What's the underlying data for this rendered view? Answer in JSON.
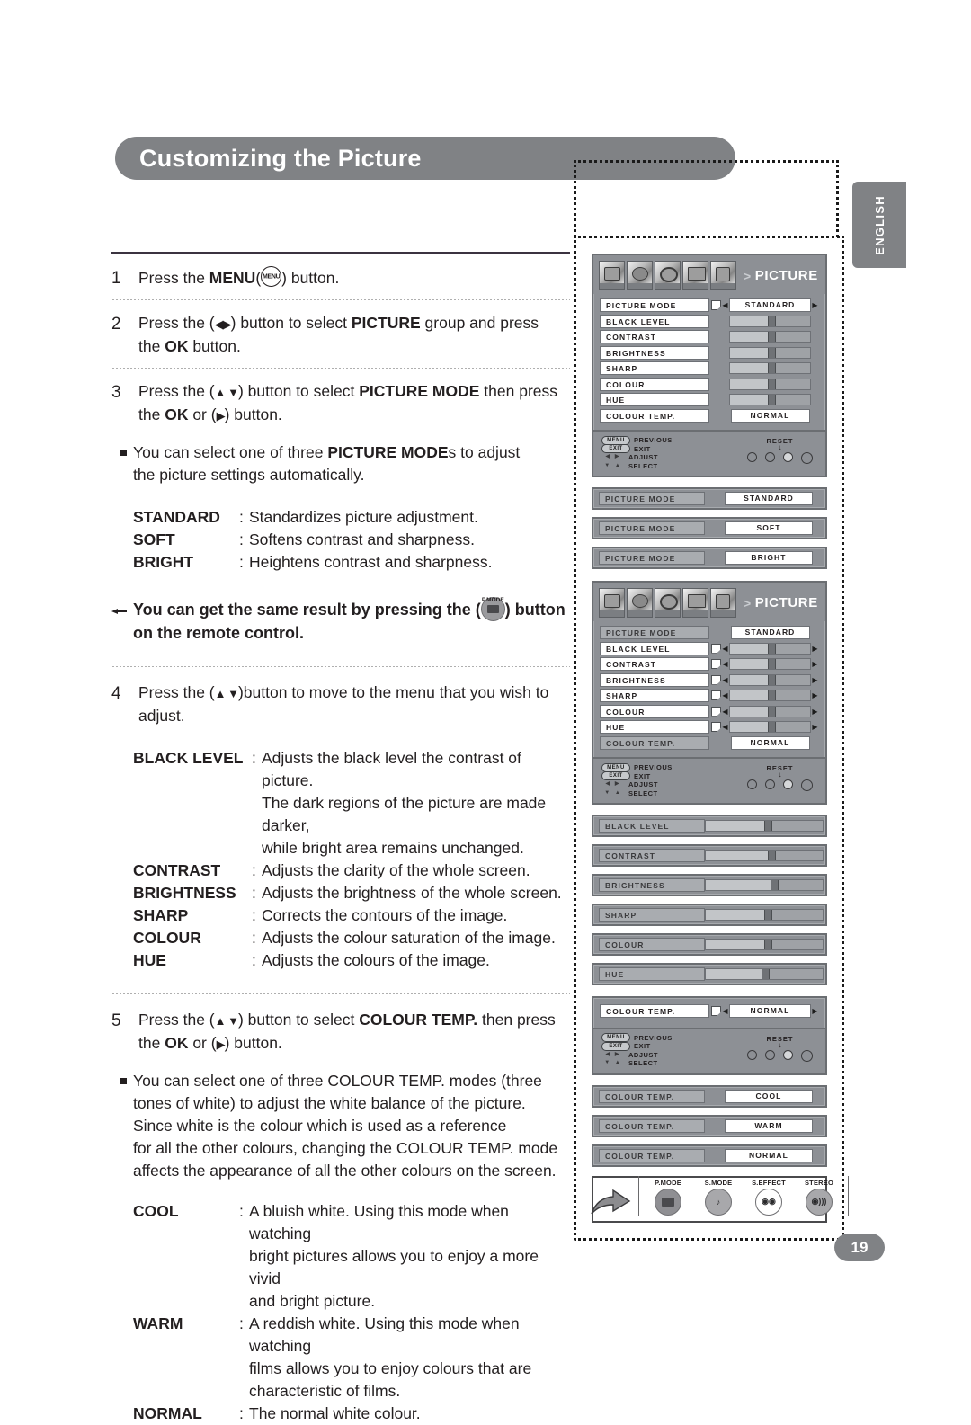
{
  "page_title": "Customizing the Picture",
  "language_tab": "ENGLISH",
  "page_number": "19",
  "colors": {
    "banner": "#808285",
    "osd_panel": "#8d9095",
    "text": "#231f20"
  },
  "steps": [
    {
      "num": "1",
      "parts": [
        {
          "t": "Press the ",
          "b": false
        },
        {
          "t": "MENU",
          "b": true
        },
        {
          "t": "(",
          "b": false
        },
        {
          "t": "@menu-icon",
          "b": false
        },
        {
          "t": ") button.",
          "b": false
        }
      ],
      "plain": "Press the MENU(MENU) button."
    },
    {
      "num": "2",
      "line1_a": "Press the (",
      "line1_arrows": "◀▶",
      "line1_b": ") button to select ",
      "line1_bold": "PICTURE",
      "line1_c": " group and press",
      "line2_a": "the ",
      "line2_bold": "OK",
      "line2_b": " button."
    },
    {
      "num": "3",
      "line1_a": "Press the (",
      "line1_arrows": "▲ ▼",
      "line1_b": ") button to select ",
      "line1_bold": "PICTURE MODE",
      "line1_c": " then press",
      "line2_a": "the ",
      "line2_bold": "OK",
      "line2_b": " or (",
      "line2_arrows": "▶",
      "line2_c": ") button."
    },
    {
      "num": "4",
      "line1_a": "Press the (",
      "line1_arrows": "▲ ▼",
      "line1_b": ")button to move to the menu that you wish to",
      "line2_a": "adjust.",
      "line2_bold": "",
      "line2_b": ""
    },
    {
      "num": "5",
      "line1_a": "Press the (",
      "line1_arrows": "▲ ▼",
      "line1_b": ") button to select ",
      "line1_bold": "COLOUR TEMP.",
      "line1_c": " then press",
      "line2_a": "the ",
      "line2_bold": "OK",
      "line2_b": " or (",
      "line2_arrows": "▶",
      "line2_c": ") button."
    }
  ],
  "bullet_step3": {
    "line1_a": "You can select one of three ",
    "line1_bold": "PICTURE MODE",
    "line1_b": "s to adjust",
    "line2": "the picture settings automatically."
  },
  "picture_modes": [
    {
      "term": "STANDARD",
      "sep": ":",
      "desc": "Standardizes picture adjustment."
    },
    {
      "term": "SOFT",
      "sep": ":",
      "desc": "Softens contrast and sharpness."
    },
    {
      "term": "BRIGHT",
      "sep": ":",
      "desc": "Heightens contrast and sharpness."
    }
  ],
  "remote_note": {
    "line1_a": "You can get the same result by pressing the (",
    "button_label": "P.MODE",
    "line1_b": ") button",
    "line2": "on the remote control."
  },
  "picture_items": [
    {
      "term": "BLACK LEVEL",
      "sep": ":",
      "desc": "Adjusts the black level the contrast of picture.",
      "cont": [
        "The dark regions of the picture are made darker,",
        "while bright area remains unchanged."
      ]
    },
    {
      "term": "CONTRAST",
      "sep": ":",
      "desc": "Adjusts the clarity of the whole screen.",
      "cont": []
    },
    {
      "term": "BRIGHTNESS",
      "sep": ":",
      "desc": "Adjusts the brightness of the whole screen.",
      "cont": []
    },
    {
      "term": "SHARP",
      "sep": ":",
      "desc": "Corrects the contours of the image.",
      "cont": []
    },
    {
      "term": "COLOUR",
      "sep": ":",
      "desc": "Adjusts the colour saturation of the image.",
      "cont": []
    },
    {
      "term": "HUE",
      "sep": ":",
      "desc": "Adjusts the colours of the image.",
      "cont": []
    }
  ],
  "bullet_step5": [
    "You can select one of three COLOUR TEMP. modes (three",
    "tones of white) to adjust the white balance of the picture.",
    "Since white is the colour which is used as a reference",
    "for all the other colours, changing the COLOUR TEMP. mode",
    "affects the appearance of all the other colours on the screen."
  ],
  "colour_temp_items": [
    {
      "term": "COOL",
      "sep": ":",
      "desc": "A bluish white. Using this mode when watching",
      "cont": [
        "bright pictures allows you to enjoy a more vivid",
        "and bright picture."
      ]
    },
    {
      "term": "WARM",
      "sep": ":",
      "desc": "A reddish white. Using this mode when watching",
      "cont": [
        "films allows you to enjoy colours that are",
        "characteristic of films."
      ]
    },
    {
      "term": "NORMAL",
      "sep": ":",
      "desc": "The normal white colour.",
      "cont": []
    }
  ],
  "osd": {
    "title": "PICTURE",
    "chevron": ">",
    "panel1": {
      "rows": [
        {
          "label": "PICTURE MODE",
          "type": "value",
          "value": "STANDARD",
          "selected": true,
          "arrows": true
        },
        {
          "label": "BLACK LEVEL",
          "type": "slider",
          "pos": 50
        },
        {
          "label": "CONTRAST",
          "type": "slider",
          "pos": 50
        },
        {
          "label": "BRIGHTNESS",
          "type": "slider",
          "pos": 50
        },
        {
          "label": "SHARP",
          "type": "slider",
          "pos": 50
        },
        {
          "label": "COLOUR",
          "type": "slider",
          "pos": 50
        },
        {
          "label": "HUE",
          "type": "slider",
          "pos": 50
        },
        {
          "label": "COLOUR TEMP.",
          "type": "value",
          "value": "NORMAL",
          "selected": false,
          "arrows": false
        }
      ]
    },
    "panel2": {
      "rows": [
        {
          "label": "PICTURE MODE",
          "type": "value",
          "value": "STANDARD",
          "selected": false,
          "arrows": false,
          "grey": true
        },
        {
          "label": "BLACK LEVEL",
          "type": "slider",
          "pos": 50,
          "arrows": true
        },
        {
          "label": "CONTRAST",
          "type": "slider",
          "pos": 50,
          "arrows": true
        },
        {
          "label": "BRIGHTNESS",
          "type": "slider",
          "pos": 50,
          "arrows": true
        },
        {
          "label": "SHARP",
          "type": "slider",
          "pos": 50,
          "arrows": true
        },
        {
          "label": "COLOUR",
          "type": "slider",
          "pos": 50,
          "arrows": true
        },
        {
          "label": "HUE",
          "type": "slider",
          "pos": 50,
          "arrows": true
        },
        {
          "label": "COLOUR TEMP.",
          "type": "value",
          "value": "NORMAL",
          "selected": false,
          "arrows": false,
          "grey": true
        }
      ]
    },
    "panel3": {
      "rows": [
        {
          "label": "COLOUR TEMP.",
          "type": "value",
          "value": "NORMAL",
          "selected": true,
          "arrows": true
        }
      ]
    },
    "legend": {
      "menu_key": "MENU",
      "menu_action": "PREVIOUS",
      "exit_key": "EXIT",
      "exit_action": "EXIT",
      "lr_arrows": "◀ ▶",
      "lr_action": "ADJUST",
      "ud_arrows": "▼ ▲",
      "ud_action": "SELECT",
      "reset_label": "RESET"
    }
  },
  "mode_strips": [
    {
      "label": "PICTURE MODE",
      "value": "STANDARD"
    },
    {
      "label": "PICTURE MODE",
      "value": "SOFT"
    },
    {
      "label": "PICTURE MODE",
      "value": "BRIGHT"
    }
  ],
  "slider_strips": [
    {
      "label": "BLACK LEVEL",
      "pos": 52
    },
    {
      "label": "CONTRAST",
      "pos": 55
    },
    {
      "label": "BRIGHTNESS",
      "pos": 58
    },
    {
      "label": "SHARP",
      "pos": 52
    },
    {
      "label": "COLOUR",
      "pos": 52
    },
    {
      "label": "HUE",
      "pos": 50
    }
  ],
  "temp_strips": [
    {
      "label": "COLOUR TEMP.",
      "value": "COOL"
    },
    {
      "label": "COLOUR TEMP.",
      "value": "WARM"
    },
    {
      "label": "COLOUR TEMP.",
      "value": "NORMAL"
    }
  ],
  "remote_buttons": [
    {
      "label": "P.MODE",
      "icon": "picture-mode-icon",
      "highlight": true
    },
    {
      "label": "S.MODE",
      "icon": "sound-mode-icon",
      "highlight": false
    },
    {
      "label": "S.EFFECT",
      "icon": "sound-effect-icon",
      "highlight": false
    },
    {
      "label": "STEREO",
      "icon": "stereo-icon",
      "highlight": false
    }
  ]
}
